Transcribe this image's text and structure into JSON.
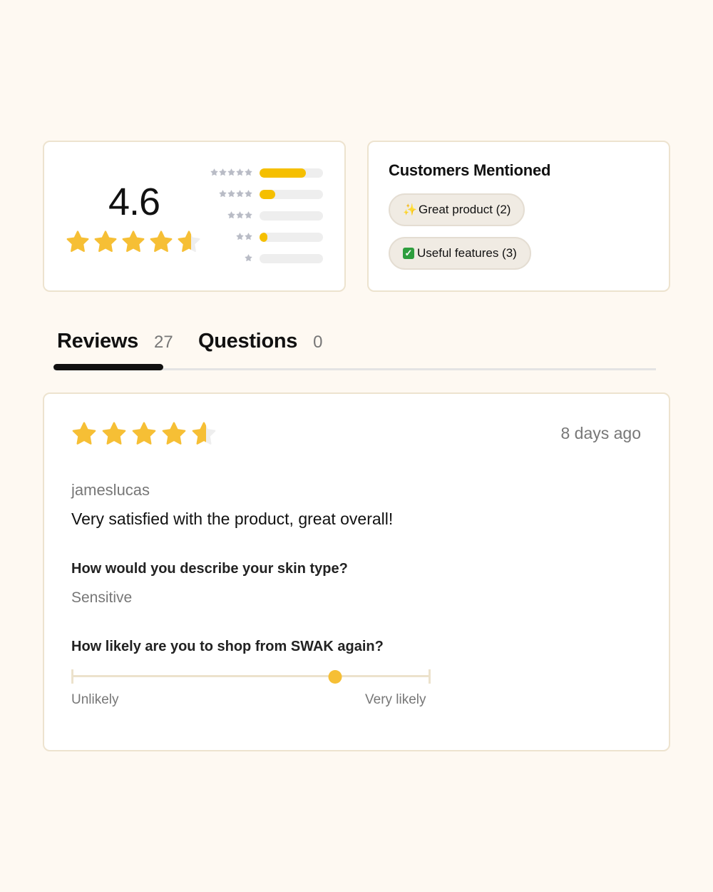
{
  "summary": {
    "average_rating": "4.6",
    "rating_value": 4.6,
    "distribution": [
      {
        "stars": 5,
        "fraction": 0.73
      },
      {
        "stars": 4,
        "fraction": 0.25
      },
      {
        "stars": 3,
        "fraction": 0.0
      },
      {
        "stars": 2,
        "fraction": 0.12
      },
      {
        "stars": 1,
        "fraction": 0.0
      }
    ]
  },
  "mentions": {
    "title": "Customers Mentioned",
    "chips": [
      {
        "icon": "sparkles-icon",
        "glyph": "✨",
        "label": "Great product (2)"
      },
      {
        "icon": "check-mark-icon",
        "glyph": "✓",
        "label": "Useful features (3)"
      }
    ]
  },
  "tabs": [
    {
      "label": "Reviews",
      "count": "27"
    },
    {
      "label": "Questions",
      "count": "0"
    }
  ],
  "review": {
    "rating_value": 4.6,
    "date": "8 days ago",
    "author": "jameslucas",
    "text": "Very satisfied with the product, great overall!",
    "question1": "How would you describe your skin type?",
    "answer1": "Sensitive",
    "question2": "How likely are you to shop from SWAK again?",
    "slider_value": 0.735,
    "slider_min_label": "Unlikely",
    "slider_max_label": "Very likely"
  },
  "colors": {
    "star_gold": "#f6bf35",
    "star_empty": "#eeeeee",
    "bar_fill": "#f5bf00",
    "small_star": "#b9bcc6"
  }
}
